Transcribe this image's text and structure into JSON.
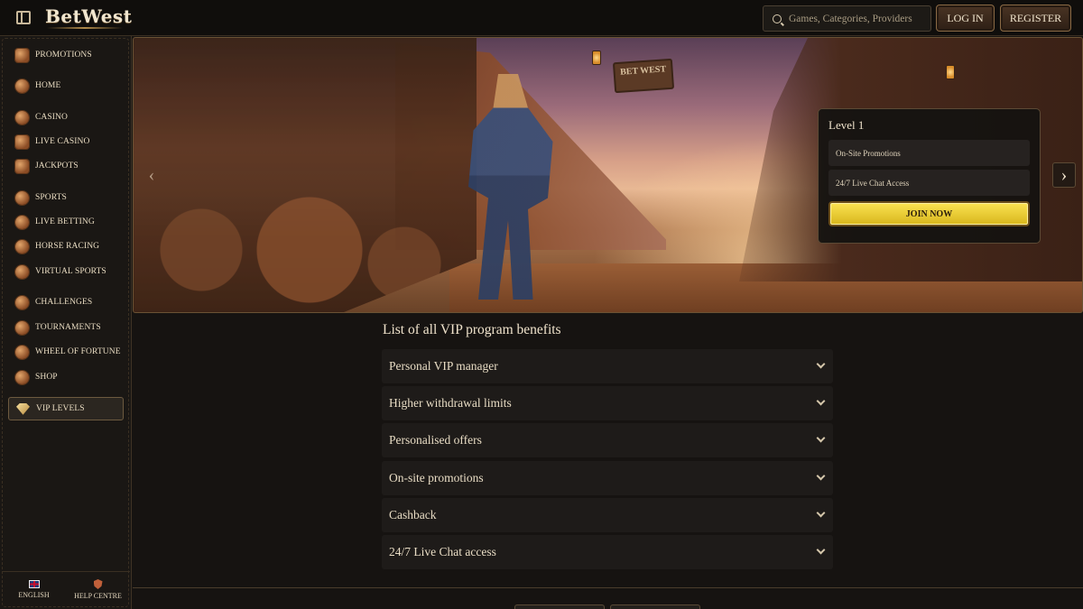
{
  "header": {
    "logo": "BetWest",
    "search_placeholder": "Games, Categories, Providers",
    "login_label": "LOG IN",
    "register_label": "REGISTER"
  },
  "sidebar": {
    "items": [
      {
        "label": "PROMOTIONS",
        "icon": "gift-icon"
      },
      {
        "label": "HOME",
        "icon": "home-shield-icon"
      },
      {
        "label": "CASINO",
        "icon": "casino-chip-icon"
      },
      {
        "label": "LIVE CASINO",
        "icon": "live-casino-icon"
      },
      {
        "label": "JACKPOTS",
        "icon": "jackpot-777-icon"
      },
      {
        "label": "SPORTS",
        "icon": "ball-icon"
      },
      {
        "label": "LIVE BETTING",
        "icon": "live-betting-icon"
      },
      {
        "label": "HORSE RACING",
        "icon": "horseshoe-icon"
      },
      {
        "label": "VIRTUAL SPORTS",
        "icon": "virtual-sports-icon"
      },
      {
        "label": "CHALLENGES",
        "icon": "challenges-icon"
      },
      {
        "label": "TOURNAMENTS",
        "icon": "trophy-icon"
      },
      {
        "label": "WHEEL OF FORTUNE",
        "icon": "wheel-icon"
      },
      {
        "label": "SHOP",
        "icon": "shop-bag-icon"
      },
      {
        "label": "VIP LEVELS",
        "icon": "gem-icon"
      }
    ],
    "language_label": "ENGLISH",
    "help_label": "HELP CENTRE"
  },
  "hero": {
    "sign_text": "BET WEST",
    "level_card": {
      "title": "Level 1",
      "rows": [
        "On-Site Promotions",
        "24/7 Live Chat Access"
      ],
      "join_label": "JOIN NOW"
    }
  },
  "benefits": {
    "title": "List of all VIP program benefits",
    "items": [
      "Personal VIP manager",
      "Higher withdrawal limits",
      "Personalised offers",
      "On-site promotions",
      "Cashback",
      "24/7 Live Chat access"
    ]
  },
  "colors": {
    "background": "#161311",
    "accent_gold": "#f4d43a",
    "text_cream": "#e8dcc4",
    "border_brown": "#8a6a45"
  }
}
